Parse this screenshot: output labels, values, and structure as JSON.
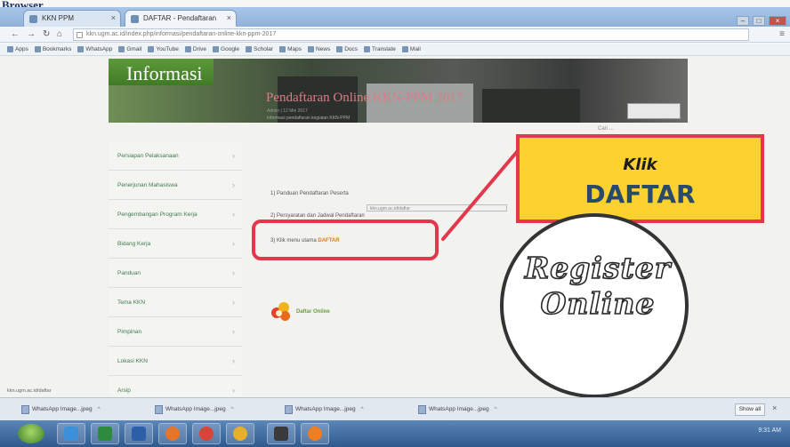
{
  "document_heading": "Browser",
  "browser": {
    "tabs": [
      {
        "label": "KKN PPM"
      },
      {
        "label": "DAFTAR - Pendaftaran",
        "active": true
      }
    ],
    "url": "kkn.ugm.ac.id/index.php/informasi/pendaftaran-online-kkn-ppm-2017",
    "bookmarks": [
      "Apps",
      "Bookmarks",
      "WhatsApp",
      "Gmail",
      "YouTube",
      "Drive",
      "Google",
      "Scholar",
      "Maps",
      "News",
      "Docs",
      "Translate",
      "Mail"
    ]
  },
  "website": {
    "banner_title": "Informasi",
    "under_banner": "Cari ...",
    "sidebar_items": [
      "Persiapan Pelaksanaan",
      "Penerjunan Mahasiswa",
      "Pengembangan Program Kerja",
      "Bidang Kerja",
      "Panduan",
      "Tema KKN",
      "Pimpinan",
      "Lokasi KKN",
      "Arsip"
    ],
    "main_title": "Pendaftaran Online KKN-PPM 2017",
    "meta": "Admin | 12 Mei 2017",
    "meta2": "Informasi pendaftaran kegiatan KKN-PPM",
    "steps": [
      {
        "prefix": "1) ",
        "text": "Panduan Pendaftaran Peserta"
      },
      {
        "prefix": "2) ",
        "text": "Persyaratan dan Jadwal Pendaftaran"
      },
      {
        "prefix": "3) ",
        "text": "Klik menu utama ",
        "highlight": "DAFTAR"
      }
    ],
    "tooltip_url": "kkn.ugm.ac.id/daftar",
    "logo_text": "Daftar Online",
    "status_url": "kkn.ugm.ac.id/daftar"
  },
  "callout": {
    "line1": "Klik",
    "line2": "DAFTAR"
  },
  "register_badge": {
    "word1": "Register",
    "word2": "Online"
  },
  "download_shelf": {
    "items": [
      "WhatsApp Image...jpeg",
      "WhatsApp Image...jpeg",
      "WhatsApp Image...jpeg",
      "WhatsApp Image...jpeg"
    ],
    "show_all": "Show all"
  },
  "taskbar": {
    "clock": "9:31 AM"
  },
  "colors": {
    "highlight_red": "#e3374e",
    "callout_yellow": "#fbd12e",
    "banner_green": "#4f8a30",
    "title_pink": "#e07a86"
  }
}
